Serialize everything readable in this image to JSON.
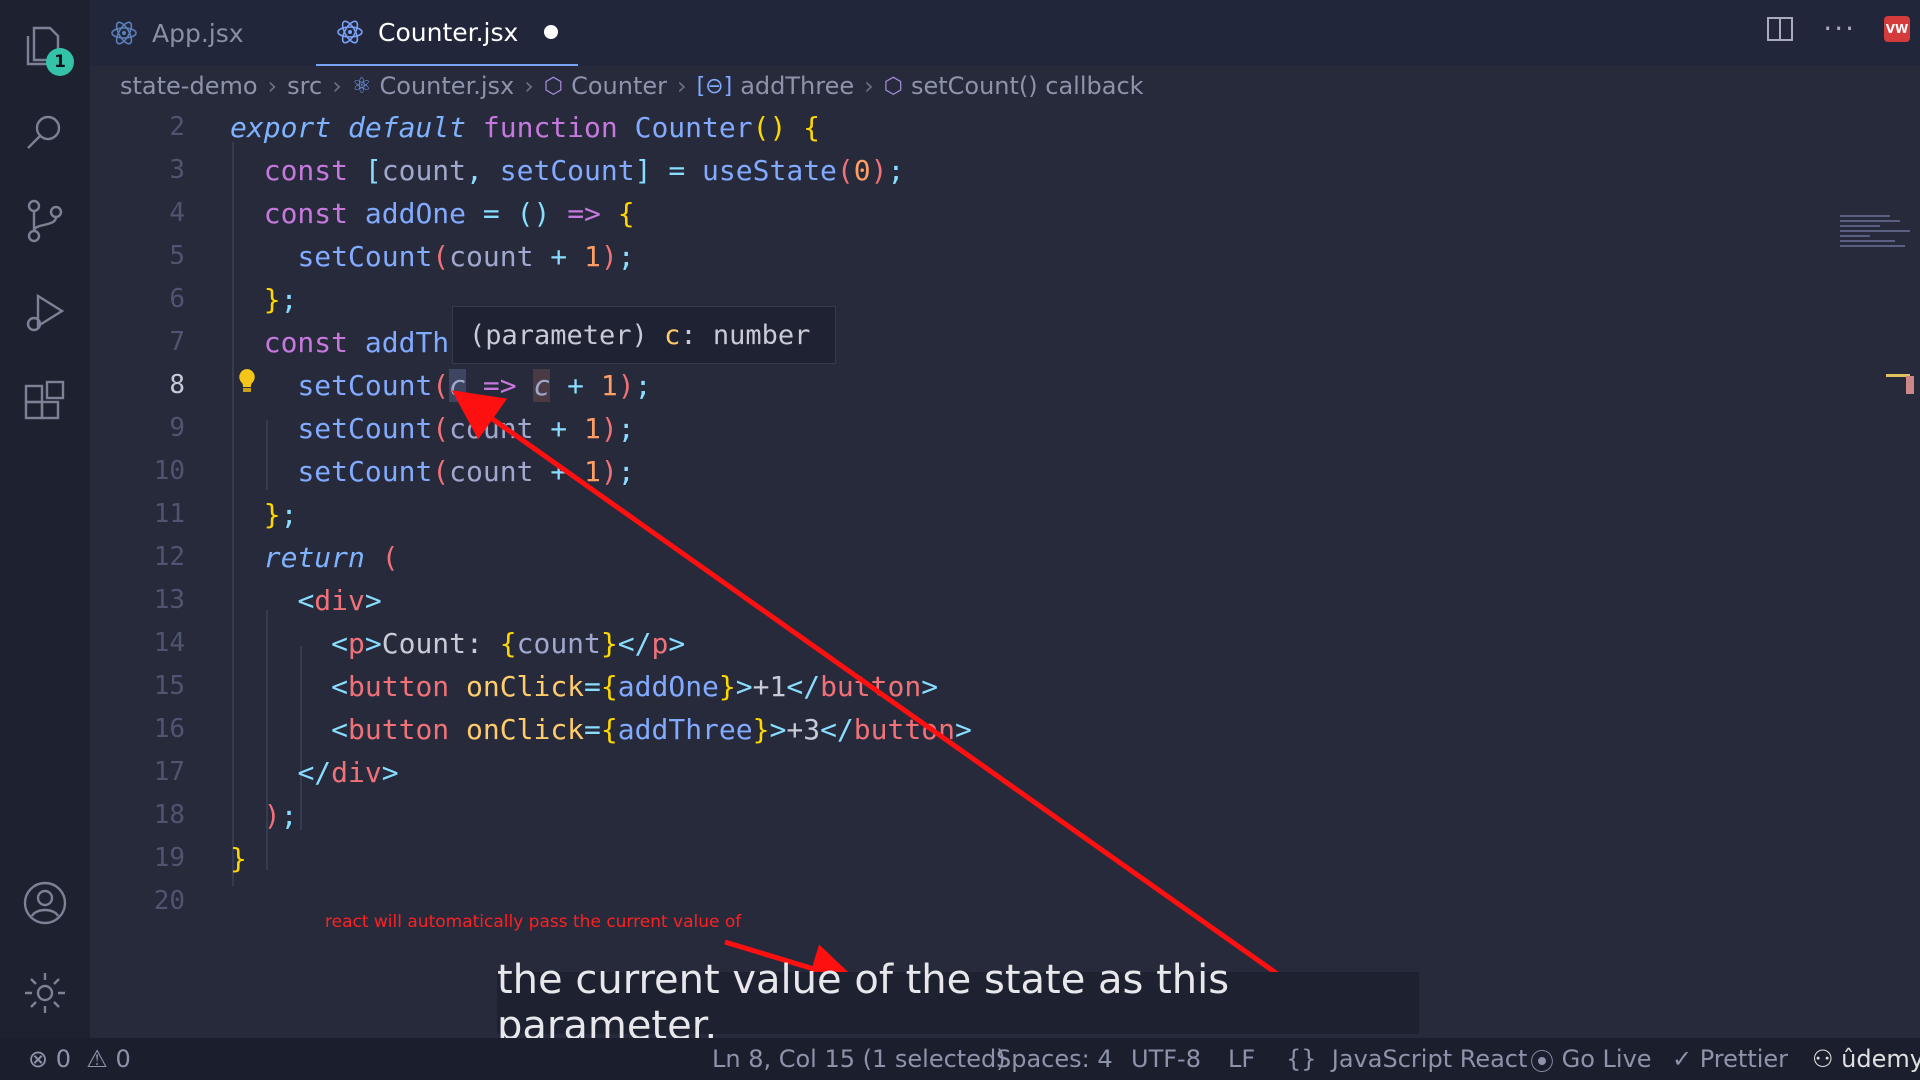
{
  "activity": {
    "explorer_badge": "1"
  },
  "tabs": [
    {
      "label": "App.jsx"
    },
    {
      "label": "Counter.jsx"
    }
  ],
  "breadcrumb": [
    "state-demo",
    "src",
    "Counter.jsx",
    "Counter",
    "addThree",
    "setCount() callback"
  ],
  "editor": {
    "line_numbers": [
      "2",
      "3",
      "4",
      "5",
      "6",
      "7",
      "8",
      "9",
      "10",
      "11",
      "12",
      "13",
      "14",
      "15",
      "16",
      "17",
      "18",
      "19",
      "20"
    ],
    "active_line": "8",
    "hover_tooltip": {
      "prefix": "(parameter) ",
      "name": "c",
      "type": ": number"
    }
  },
  "annotation_note": "react will automatically pass the current value of",
  "subtitle": "the current value of the state as this parameter.",
  "status": {
    "errors": "0",
    "warnings": "0",
    "cursor": "Ln 8, Col 15 (1 selected)",
    "spaces": "Spaces: 4",
    "encoding": "UTF-8",
    "eol": "LF",
    "language": "JavaScript React",
    "go_live": "Go Live",
    "prettier": "Prettier",
    "brand": "ûdemy"
  }
}
